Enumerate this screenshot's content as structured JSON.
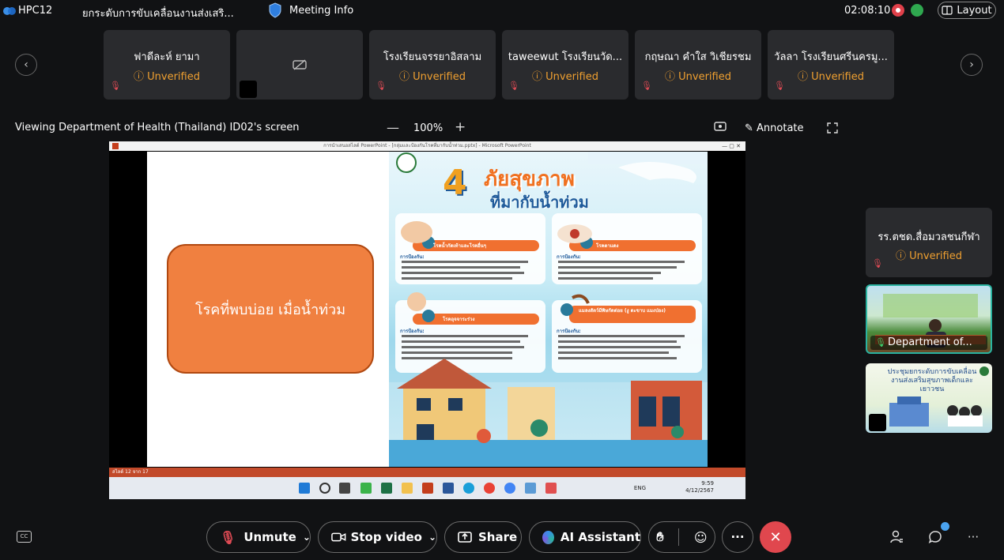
{
  "titlebar": {
    "app_name": "HPC12",
    "meeting_title": "ยกระดับการขับเคลื่อนงานส่งเสริ...",
    "info_label": "Meeting Info",
    "elapsed": "02:08:10",
    "layout_label": "Layout"
  },
  "participants": [
    {
      "name": "ฟาดีละห์ ยามา",
      "status": "Unverified"
    },
    {
      "name": "",
      "status": ""
    },
    {
      "name": "โรงเรียนจรรยาอิสลาม",
      "status": "Unverified"
    },
    {
      "name": "taweewut โรงเรียนวัด...",
      "status": "Unverified"
    },
    {
      "name": "กฤษณา คำใส วิเชียรชม",
      "status": "Unverified"
    },
    {
      "name": "วัลลา  โรงเรียนศรีนครมู...",
      "status": "Unverified"
    }
  ],
  "share": {
    "viewing_text": "Viewing Department of Health (Thailand) ID02's screen",
    "zoom": "100%",
    "annotate_label": "Annotate",
    "window_title": "การนำเสนอสไลด์ PowerPoint - [กลุ่มและป้องกันโรคที่มากับน้ำท่วม.pptx] - Microsoft PowerPoint",
    "slide_text": "โรคที่พบบ่อย เมื่อน้ำท่วม",
    "poster": {
      "number": "4",
      "title_line1": "ภัยสุขภาพ",
      "title_line2": "ที่มากับน้ำท่วม",
      "card1": "โรคน้ำกัดเท้าและโรคอื่นๆ",
      "card2": "โรคตาแดง",
      "card3": "โรคอุจจาระร่วง",
      "card4": "แมลงสัตว์มีพิษกัดต่อย (งู ตะขาบ แมงป่อง)",
      "prevent_label": "การป้องกัน:"
    },
    "status_text": "สไลด์ 12 จาก 17",
    "taskbar": {
      "lang": "ENG",
      "time": "9:59",
      "date": "4/12/2567"
    }
  },
  "side": {
    "tile_name": "รร.ตชด.สื่อมวลชนกีฬา",
    "tile_status": "Unverified",
    "video1_label": "Department of...",
    "video2_caption": "ประชุมยกระดับการขับเคลื่อนงานส่งเสริมสุขภาพเด็กและเยาวชน"
  },
  "controls": {
    "unmute": "Unmute",
    "stop_video": "Stop video",
    "share": "Share",
    "ai_assistant": "AI Assistant"
  },
  "colors": {
    "accent_warning": "#f0a030",
    "end_call": "#e0474e",
    "active_tile_border": "#2ab3a0",
    "slide_box": "#f08040"
  }
}
